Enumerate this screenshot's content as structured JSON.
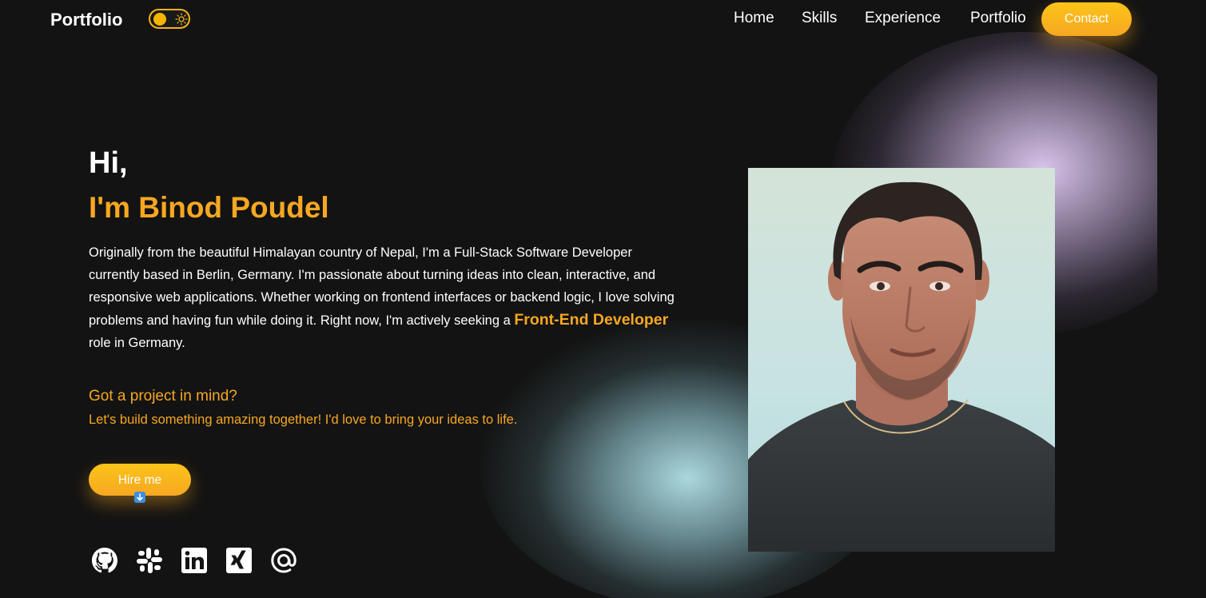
{
  "header": {
    "logo": "Portfolio",
    "nav": [
      "Home",
      "Skills",
      "Experience",
      "Portfolio"
    ],
    "contact_label": "Contact"
  },
  "hero": {
    "greeting": "Hi,",
    "name": "I'm Binod Poudel",
    "bio_before": "Originally from the beautiful Himalayan country of Nepal, I'm a Full-Stack Software Developer currently based in Berlin, Germany. I'm passionate about turning ideas into clean, interactive, and responsive web applications. Whether working on frontend interfaces or backend logic, I love solving problems and having fun while doing it. Right now, I'm actively seeking a ",
    "bio_highlight": "Front-End Developer",
    "bio_after": " role in Germany.",
    "cta_title": "Got a project in mind?",
    "cta_subtitle": "Let's build something amazing together! I'd love to bring your ideas to life.",
    "hire_label": "Hire me"
  },
  "socials": [
    "github-icon",
    "slack-icon",
    "linkedin-icon",
    "xing-icon",
    "at-sign-icon"
  ],
  "colors": {
    "accent": "#f7a721",
    "button_top": "#fcc419",
    "background": "#131313",
    "text": "#ffffff"
  }
}
